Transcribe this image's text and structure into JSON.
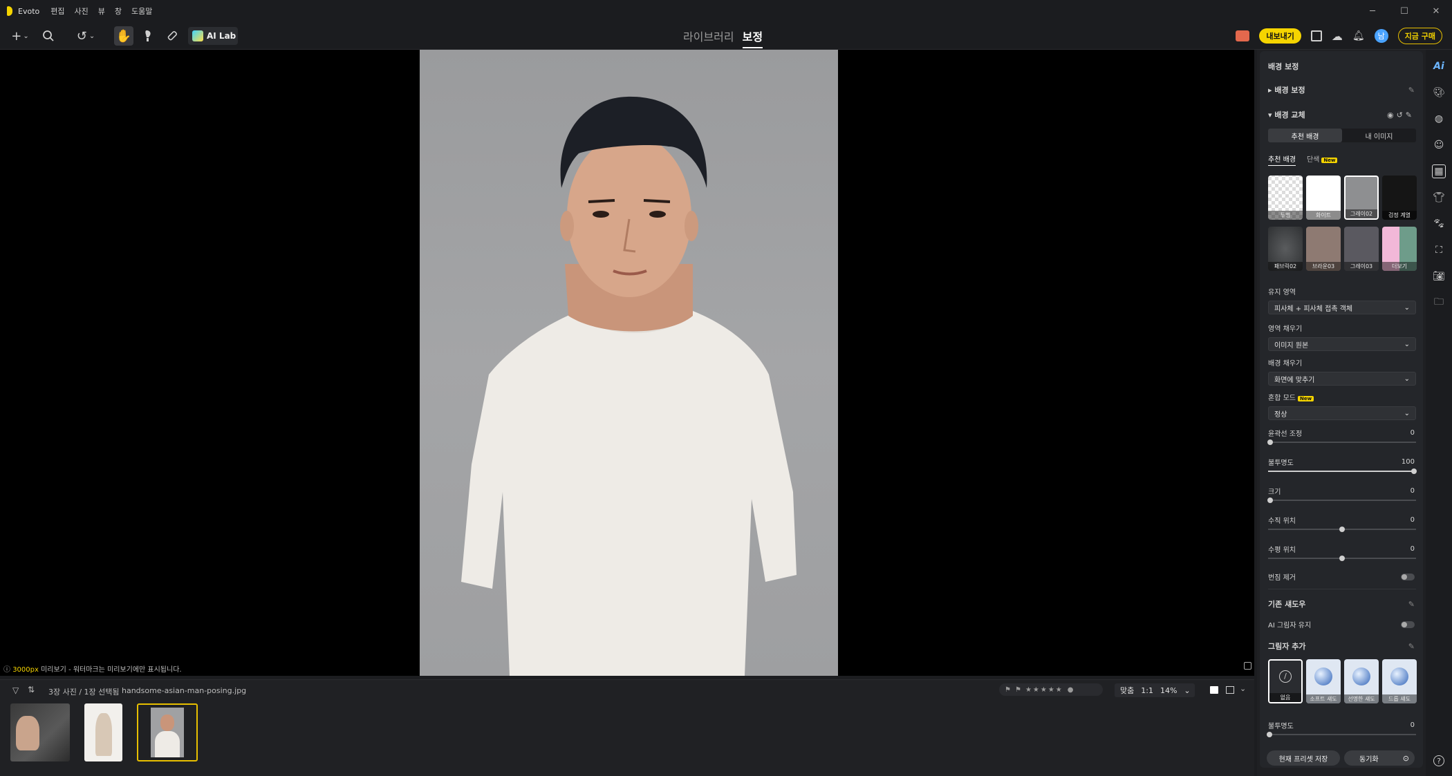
{
  "titlebar": {
    "app_name": "Evoto",
    "menu": [
      "편집",
      "사진",
      "뷰",
      "창",
      "도움말"
    ]
  },
  "toolbar": {
    "ai_lab_label": "AI Lab",
    "tabs": [
      {
        "label": "라이브러리",
        "active": false
      },
      {
        "label": "보정",
        "active": true
      }
    ],
    "export_label": "내보내기",
    "buy_label": "지금 구매",
    "avatar_letter": "남"
  },
  "canvas": {
    "note_highlight": "3000px",
    "note_text": " 미리보기 - 워터마크는 미리보기에만 표시됩니다."
  },
  "filmstrip": {
    "count_text": "3장 사진 / 1장 선택됨",
    "filename": "handsome-asian-man-posing.jpg",
    "fit_label": "맞춤",
    "ratio_label": "1:1",
    "zoom_label": "14%"
  },
  "panel": {
    "header_title": "배경 보정",
    "section_bg_correction": "배경 보정",
    "section_bg_replace": "배경 교체",
    "seg_recommended": "추천 배경",
    "seg_my_images": "내 이미지",
    "subtab_recommended": "추천 배경",
    "subtab_solid": "단색",
    "new_badge": "New",
    "tiles": [
      {
        "label": "투명"
      },
      {
        "label": "화이트"
      },
      {
        "label": "그레이02"
      },
      {
        "label": "검정 계열"
      },
      {
        "label": "패브릭02"
      },
      {
        "label": "브라운03"
      },
      {
        "label": "그레이03"
      },
      {
        "label": "더보기"
      }
    ],
    "keep_area_label": "유지 영역",
    "keep_area_value": "피사체 + 피사체 접촉 객체",
    "fill_area_label": "영역 채우기",
    "fill_area_value": "이미지 원본",
    "bg_fill_label": "배경 채우기",
    "bg_fill_value": "화면에 맞추기",
    "blend_label": "혼합 모드",
    "blend_value": "정상",
    "sliders": [
      {
        "label": "윤곽선 조정",
        "value": "0",
        "fraction": 0.0
      },
      {
        "label": "불투명도",
        "value": "100",
        "fraction": 1.0
      },
      {
        "label": "크기",
        "value": "0",
        "fraction": 0.0
      },
      {
        "label": "수직 위치",
        "value": "0",
        "fraction": 0.5
      },
      {
        "label": "수평 위치",
        "value": "0",
        "fraction": 0.5
      }
    ],
    "defringe_label": "번짐 제거",
    "existing_shadow_label": "기존 섀도우",
    "ai_shadow_label": "AI 그림자 유지",
    "add_shadow_label": "그림자 추가",
    "shadow_tiles": [
      {
        "label": "없음"
      },
      {
        "label": "소프트 섀도"
      },
      {
        "label": "선명한 섀도"
      },
      {
        "label": "드롭 섀도"
      }
    ],
    "shadow_opacity_label": "불투명도",
    "shadow_opacity_value": "0",
    "save_preset_label": "현재 프리셋 저장",
    "sync_label": "동기화"
  },
  "colors": {
    "accent": "#f5d400",
    "panel_bg": "#24262a",
    "canvas_bg": "#000000"
  }
}
